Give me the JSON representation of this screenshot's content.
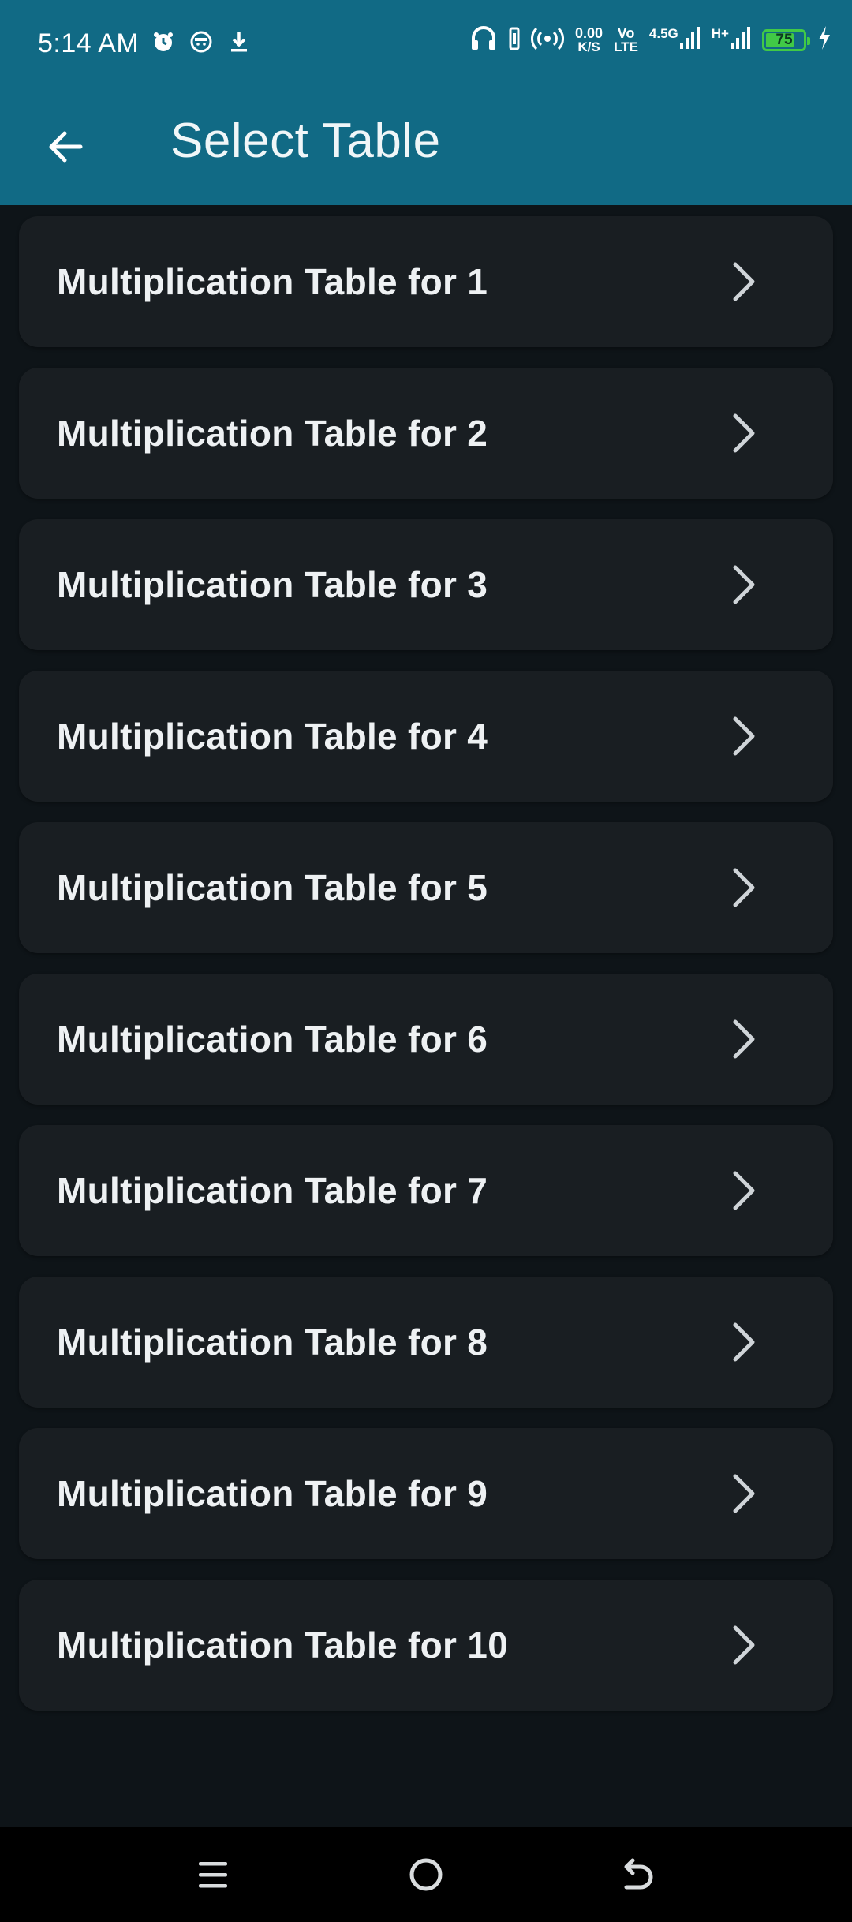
{
  "status_bar": {
    "time": "5:14 AM",
    "net_speed_value": "0.00",
    "net_speed_unit": "K/S",
    "volte_top": "Vo",
    "volte_bottom": "LTE",
    "network_1": "4.5G",
    "network_2": "H+",
    "battery_level": "75",
    "battery_fraction": 0.75,
    "icons": [
      "alarm-icon",
      "face-icon",
      "download-icon",
      "headphones-icon",
      "vibrate-icon",
      "hotspot-icon",
      "signal-icon",
      "charging-icon"
    ]
  },
  "app_bar": {
    "title": "Select Table",
    "back_icon": "arrow-back-icon",
    "color": "#116a85"
  },
  "tables": {
    "items": [
      {
        "label": "Multiplication Table for 1"
      },
      {
        "label": "Multiplication Table for 2"
      },
      {
        "label": "Multiplication Table for 3"
      },
      {
        "label": "Multiplication Table for 4"
      },
      {
        "label": "Multiplication Table for 5"
      },
      {
        "label": "Multiplication Table for 6"
      },
      {
        "label": "Multiplication Table for 7"
      },
      {
        "label": "Multiplication Table for 8"
      },
      {
        "label": "Multiplication Table for 9"
      },
      {
        "label": "Multiplication Table for 10"
      }
    ],
    "chevron_icon": "chevron-right-icon"
  },
  "nav_bar": {
    "icons": [
      "menu-icon",
      "home-icon",
      "back-icon"
    ]
  }
}
